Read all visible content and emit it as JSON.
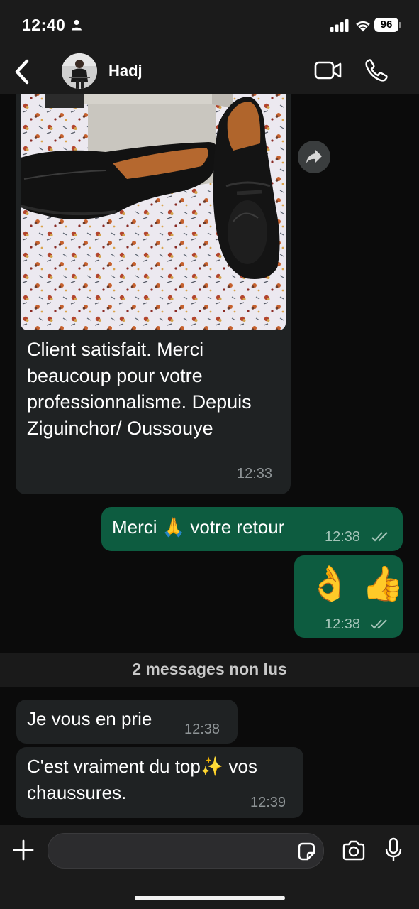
{
  "status_bar": {
    "time": "12:40",
    "battery": "96"
  },
  "header": {
    "contact_name": "Hadj"
  },
  "messages": [
    {
      "direction": "in",
      "type": "image",
      "caption": "Client satisfait. Merci beaucoup pour votre professionnalisme. Depuis Ziguinchor/ Oussouye",
      "time": "12:33"
    },
    {
      "direction": "out",
      "text_before": "Merci",
      "emoji": "🙏",
      "text_after": "votre retour",
      "time": "12:38",
      "status": "read"
    },
    {
      "direction": "out",
      "emoji_only": "👌 👍",
      "time": "12:38",
      "status": "read"
    },
    {
      "direction": "in",
      "text": "Je vous en prie",
      "time": "12:38"
    },
    {
      "direction": "in",
      "text_line1_before": "C'est vraiment du top",
      "emoji": "✨",
      "text_line1_after": "vos",
      "text_line2": "chaussures.",
      "time": "12:39"
    }
  ],
  "unread_divider": "2 messages non lus",
  "composer": {
    "placeholder": ""
  },
  "colors": {
    "incoming_bubble": "#1f2223",
    "outgoing_bubble": "#0d5c40",
    "background": "#0b0b0b",
    "bar": "#1b1b1b"
  }
}
